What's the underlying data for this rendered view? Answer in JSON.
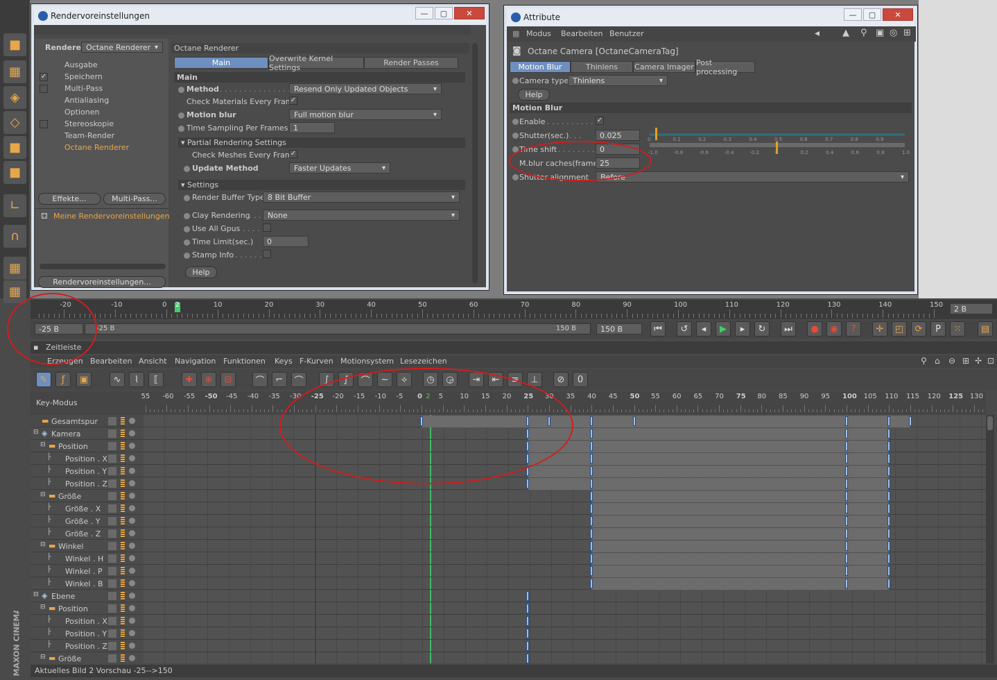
{
  "render_settings": {
    "title": "Rendervoreinstellungen",
    "renderer_label": "Renderer",
    "renderer_value": "Octane Renderer",
    "tree_items": [
      "Ausgabe",
      "Speichern",
      "Multi-Pass",
      "Antialiasing",
      "Optionen",
      "Stereoskopie",
      "Team-Render",
      "Octane Renderer"
    ],
    "effekte_button": "Effekte...",
    "multipass_button": "Multi-Pass...",
    "preset_item": "Meine Rendervoreinstellungen",
    "bottom_button": "Rendervoreinstellungen...",
    "panel_title": "Octane Renderer",
    "tabs": [
      "Main",
      "Overwrite Kernel Settings",
      "Render Passes"
    ],
    "section_main": "Main",
    "method_label": "Method",
    "method_value": "Resend Only Updated Objects",
    "check_materials_label": "Check Materials Every Frame",
    "motion_blur_label": "Motion blur",
    "motion_blur_value": "Full motion blur",
    "time_sampling_label": "Time Sampling Per Frames",
    "time_sampling_value": "1",
    "section_partial": "Partial Rendering Settings",
    "check_meshes_label": "Check Meshes Every Frame",
    "update_method_label": "Update Method",
    "update_method_value": "Faster Updates",
    "section_settings": "Settings",
    "render_buffer_label": "Render Buffer Type",
    "render_buffer_value": "8 Bit Buffer",
    "clay_label": "Clay Rendering",
    "clay_value": "None",
    "use_all_gpus_label": "Use All Gpus",
    "time_limit_label": "Time Limit(sec.)",
    "time_limit_value": "0",
    "stamp_label": "Stamp Info",
    "help": "Help"
  },
  "attribute": {
    "title": "Attribute",
    "menu": [
      "Modus",
      "Bearbeiten",
      "Benutzer"
    ],
    "object": "Octane Camera [OctaneCameraTag]",
    "tabs": [
      "Motion Blur",
      "Thinlens",
      "Camera Imager",
      "Post processing"
    ],
    "camera_type_label": "Camera type",
    "camera_type_value": "Thinlens",
    "help": "Help",
    "section": "Motion Blur",
    "enable_label": "Enable",
    "shutter_label": "Shutter(sec.)",
    "shutter_value": "0.025",
    "time_shift_label": "Time shift",
    "time_shift_value": "0",
    "caches_label": "M.blur caches(frame)",
    "caches_value": "25",
    "alignment_label": "Shutter alignment",
    "alignment_value": "Before",
    "shutter_ticks": [
      "0",
      "0.1",
      "0.2",
      "0.3",
      "0.4",
      "0.5",
      "0.6",
      "0.7",
      "0.8",
      "0.9"
    ],
    "shift_ticks": [
      "-1.0",
      "-0.8",
      "-0.6",
      "-0.4",
      "-0.2",
      "0",
      "0.2",
      "0.4",
      "0.6",
      "0.8",
      "1.0"
    ]
  },
  "timeline_ruler": {
    "labels": [
      "-20",
      "-10",
      "0",
      "2",
      "10",
      "20",
      "30",
      "40",
      "50",
      "60",
      "70",
      "80",
      "90",
      "100",
      "110",
      "120",
      "130",
      "140",
      "150"
    ],
    "frame_display": "2 B",
    "range_start": "-25 B",
    "range_inner_start": "-25 B",
    "range_inner_end": "150 B",
    "range_end": "150 B"
  },
  "zeitleiste": {
    "title": "Zeitleiste",
    "menu": [
      "Erzeugen",
      "Bearbeiten",
      "Ansicht",
      "Navigation",
      "Funktionen",
      "Keys",
      "F-Kurven",
      "Motionsystem",
      "Lesezeichen"
    ],
    "mode": "Key-Modus",
    "ruler": [
      "55",
      "-60",
      "-55",
      "-50",
      "-45",
      "-40",
      "-35",
      "-30",
      "-25",
      "-20",
      "-15",
      "-10",
      "-5",
      "0",
      "2",
      "5",
      "10",
      "15",
      "20",
      "25",
      "30",
      "35",
      "40",
      "45",
      "50",
      "55",
      "60",
      "65",
      "70",
      "75",
      "80",
      "85",
      "90",
      "95",
      "100",
      "105",
      "110",
      "115",
      "120",
      "125",
      "130"
    ],
    "tracks": [
      {
        "name": "Gesamtspur",
        "level": 0
      },
      {
        "name": "Kamera",
        "level": 0
      },
      {
        "name": "Position",
        "level": 1
      },
      {
        "name": "Position . X",
        "level": 2
      },
      {
        "name": "Position . Y",
        "level": 2
      },
      {
        "name": "Position . Z",
        "level": 2
      },
      {
        "name": "Größe",
        "level": 1
      },
      {
        "name": "Größe . X",
        "level": 2
      },
      {
        "name": "Größe . Y",
        "level": 2
      },
      {
        "name": "Größe . Z",
        "level": 2
      },
      {
        "name": "Winkel",
        "level": 1
      },
      {
        "name": "Winkel . H",
        "level": 2
      },
      {
        "name": "Winkel . P",
        "level": 2
      },
      {
        "name": "Winkel . B",
        "level": 2
      },
      {
        "name": "Ebene",
        "level": 0
      },
      {
        "name": "Position",
        "level": 1
      },
      {
        "name": "Position . X",
        "level": 2
      },
      {
        "name": "Position . Y",
        "level": 2
      },
      {
        "name": "Position . Z",
        "level": 2
      },
      {
        "name": "Größe",
        "level": 1
      }
    ],
    "status": "Aktuelles Bild  2  Vorschau  -25-->150"
  },
  "brand": "MAXON CINEMA 4D"
}
